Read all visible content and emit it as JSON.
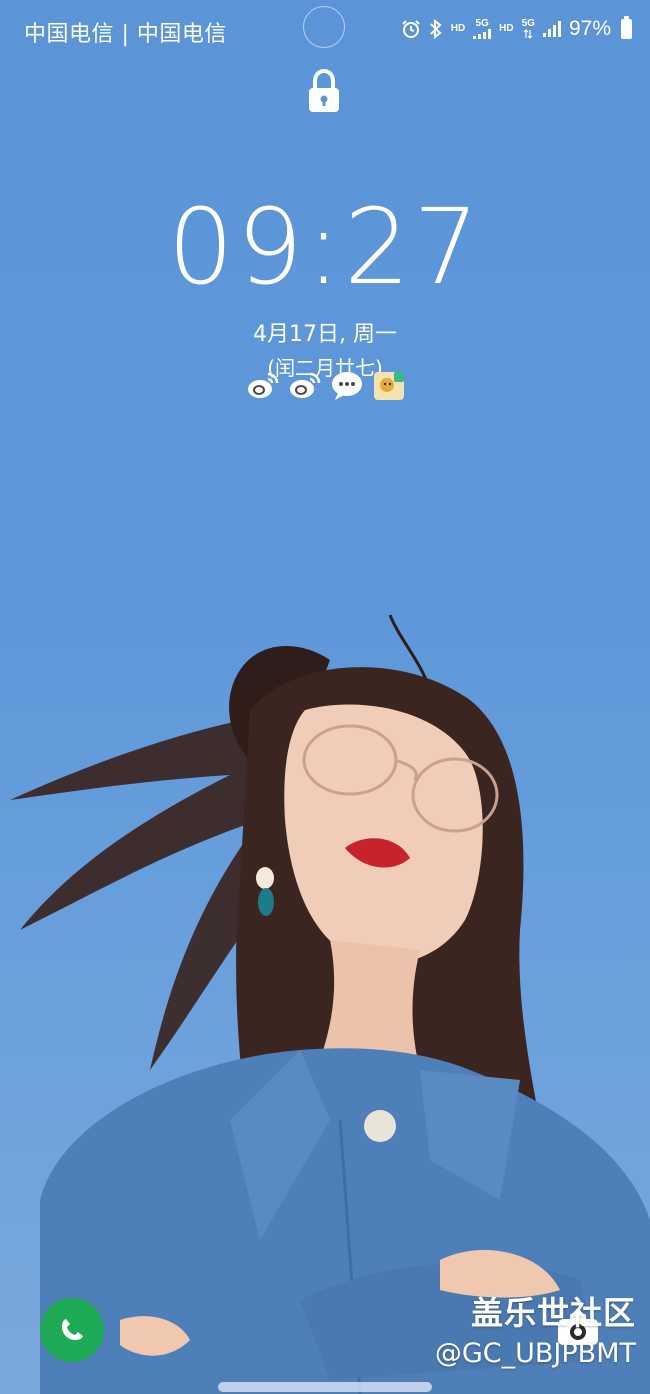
{
  "status_bar": {
    "carrier_text": "中国电信 | 中国电信",
    "hd_label_1": "HD",
    "network_1": "5G",
    "hd_label_2": "HD",
    "network_2": "5G",
    "battery_percent": "97%",
    "battery_level": 0.97,
    "icons": [
      "alarm-icon",
      "bluetooth-icon",
      "signal-icon",
      "signal-icon",
      "battery-icon"
    ]
  },
  "lock_screen": {
    "lock_icon": "lock-icon",
    "time": "09:27",
    "date": "4月17日, 周一",
    "lunar_date": "(闰二月廿七)"
  },
  "notifications": {
    "icons": [
      "weibo-icon",
      "weibo-icon",
      "message-icon",
      "app-icon"
    ]
  },
  "shortcuts": {
    "left": "phone-icon",
    "right": "camera-icon"
  },
  "watermark": {
    "community": "盖乐世社区",
    "user_id": "@GC_UBJPBMT"
  },
  "colors": {
    "sky": "#5b95d8",
    "phone_green": "#1faa56",
    "text": "#ffffff"
  }
}
